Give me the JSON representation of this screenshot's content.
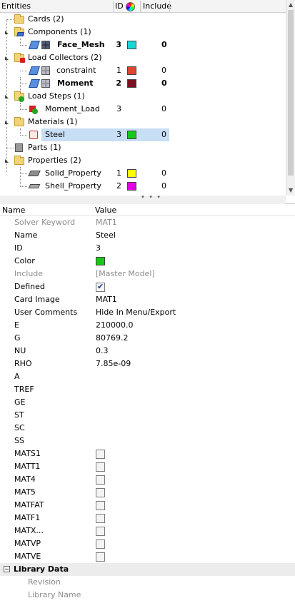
{
  "tree": {
    "header": {
      "entities": "Entities",
      "id": "ID",
      "include": "Include",
      "color_icon": "color-wheel-icon"
    },
    "rows": [
      {
        "label": "Cards (2)",
        "id": "",
        "include": "",
        "color": ""
      },
      {
        "label": "Components (1)",
        "id": "",
        "include": "",
        "color": ""
      },
      {
        "label": "Face_Mesh",
        "id": "3",
        "include": "0",
        "color": "#17d6d6"
      },
      {
        "label": "Load Collectors (2)",
        "id": "",
        "include": "",
        "color": ""
      },
      {
        "label": "constraint",
        "id": "1",
        "include": "0",
        "color": "#e0462f"
      },
      {
        "label": "Moment",
        "id": "2",
        "include": "0",
        "color": "#7a1020"
      },
      {
        "label": "Load Steps (1)",
        "id": "",
        "include": "",
        "color": ""
      },
      {
        "label": "Moment_Load",
        "id": "3",
        "include": "0",
        "color": ""
      },
      {
        "label": "Materials (1)",
        "id": "",
        "include": "",
        "color": ""
      },
      {
        "label": "Steel",
        "id": "3",
        "include": "0",
        "color": "#17c917"
      },
      {
        "label": "Parts (1)",
        "id": "",
        "include": "",
        "color": ""
      },
      {
        "label": "Properties (2)",
        "id": "",
        "include": "",
        "color": ""
      },
      {
        "label": "Solid_Property",
        "id": "1",
        "include": "0",
        "color": "#ffff00"
      },
      {
        "label": "Shell_Property",
        "id": "2",
        "include": "0",
        "color": "#e600e6"
      }
    ],
    "hscroll_dots": "• • •"
  },
  "props": {
    "header": {
      "name": "Name",
      "value": "Value"
    },
    "rows": [
      {
        "name": "Solver Keyword",
        "value": "MAT1"
      },
      {
        "name": "Name",
        "value": "Steel"
      },
      {
        "name": "ID",
        "value": "3"
      },
      {
        "name": "Color",
        "value": ""
      },
      {
        "name": "Include",
        "value": "[Master Model]"
      },
      {
        "name": "Defined",
        "value": ""
      },
      {
        "name": "Card Image",
        "value": "MAT1"
      },
      {
        "name": "User Comments",
        "value": "Hide In Menu/Export"
      },
      {
        "name": "E",
        "value": "210000.0"
      },
      {
        "name": "G",
        "value": "80769.2"
      },
      {
        "name": "NU",
        "value": "0.3"
      },
      {
        "name": "RHO",
        "value": "7.85e-09"
      },
      {
        "name": "A",
        "value": ""
      },
      {
        "name": "TREF",
        "value": ""
      },
      {
        "name": "GE",
        "value": ""
      },
      {
        "name": "ST",
        "value": ""
      },
      {
        "name": "SC",
        "value": ""
      },
      {
        "name": "SS",
        "value": ""
      },
      {
        "name": "MATS1",
        "value": ""
      },
      {
        "name": "MATT1",
        "value": ""
      },
      {
        "name": "MAT4",
        "value": ""
      },
      {
        "name": "MAT5",
        "value": ""
      },
      {
        "name": "MATFAT",
        "value": ""
      },
      {
        "name": "MATF1",
        "value": ""
      },
      {
        "name": "MATX...",
        "value": ""
      },
      {
        "name": "MATVP",
        "value": ""
      },
      {
        "name": "MATVE",
        "value": ""
      }
    ],
    "color_value": "#17c917",
    "defined_checked": true,
    "library": {
      "title": "Library Data",
      "rows": [
        {
          "name": "Revision"
        },
        {
          "name": "Library Name"
        }
      ]
    }
  }
}
